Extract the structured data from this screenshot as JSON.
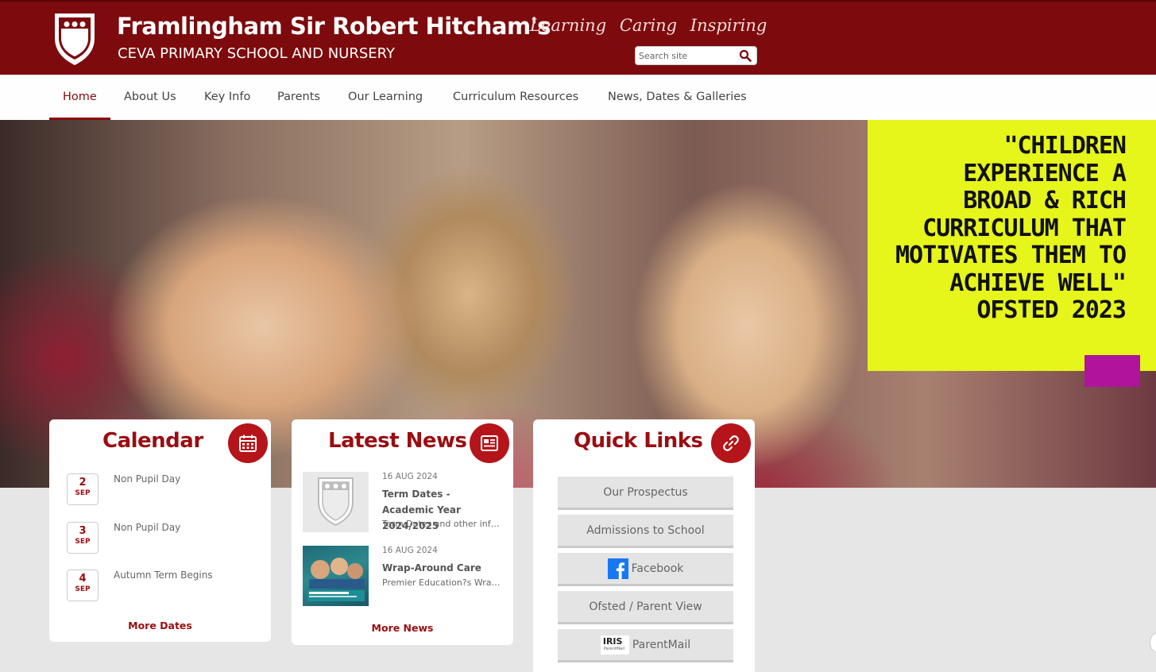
{
  "header": {
    "school_name": "Framlingham Sir Robert Hitcham's",
    "school_subtitle": "CEVA PRIMARY SCHOOL AND NURSERY",
    "motto": "Learning  Caring  Inspiring",
    "search_placeholder": "Search site",
    "colors": {
      "brand": "#7d0a0c",
      "accent": "#9b0d11"
    }
  },
  "nav": {
    "items": [
      "Home",
      "About Us",
      "Key Info",
      "Parents",
      "Our Learning",
      "Curriculum Resources",
      "News, Dates & Galleries"
    ],
    "active": "Home"
  },
  "hero": {
    "quote": "\"CHILDREN EXPERIENCE A BROAD & RICH CURRICULUM THAT MOTIVATES THEM TO ACHIEVE WELL\" OFSTED 2023",
    "quote_color": "#e6f51a"
  },
  "calendar": {
    "title": "Calendar",
    "icon": "calendar-icon",
    "events": [
      {
        "day": "2",
        "month": "SEP",
        "title": "Non Pupil Day"
      },
      {
        "day": "3",
        "month": "SEP",
        "title": "Non Pupil Day"
      },
      {
        "day": "4",
        "month": "SEP",
        "title": "Autumn Term Begins"
      }
    ],
    "more_label": "More Dates"
  },
  "news": {
    "title": "Latest News",
    "icon": "newspaper-icon",
    "items": [
      {
        "date": "16 AUG 2024",
        "title": "Term Dates - Academic Year 2024/2025",
        "excerpt": "Term Dates and other infor..."
      },
      {
        "date": "16 AUG 2024",
        "title": "Wrap-Around Care",
        "excerpt": "Premier Education?s Wrap-..."
      }
    ],
    "more_label": "More News"
  },
  "quick_links": {
    "title": "Quick Links",
    "icon": "link-icon",
    "items": [
      "Our Prospectus",
      "Admissions to School",
      "Facebook",
      "Ofsted / Parent View",
      "ParentMail"
    ],
    "iris_label": "IRIS",
    "iris_sub": "ParentMail"
  }
}
